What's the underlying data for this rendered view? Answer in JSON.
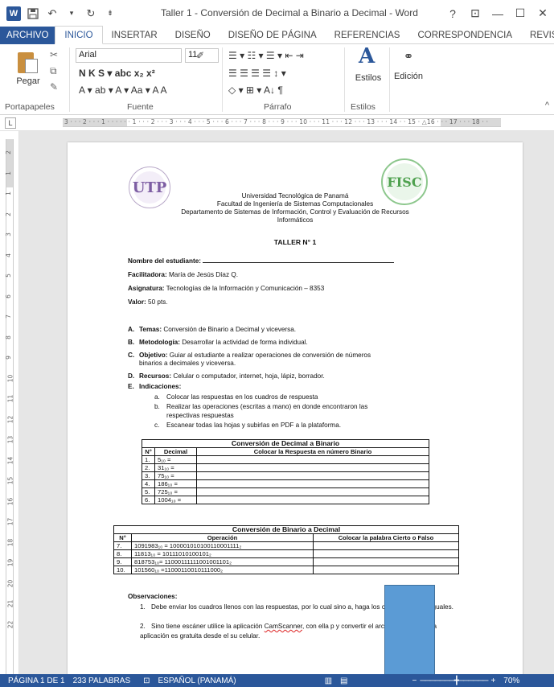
{
  "app": {
    "title": "Taller 1 - Conversión de Decimal a Binario a Decimal - Word",
    "window_controls": [
      "?",
      "⊡",
      "—",
      "☐",
      "✕"
    ]
  },
  "qat": {
    "icons": [
      "word-logo",
      "save-icon",
      "undo-icon",
      "redo-icon",
      "customize-icon"
    ],
    "word_logo_text": "W"
  },
  "tabs": [
    "ARCHIVO",
    "INICIO",
    "INSERTAR",
    "DISEÑO",
    "DISEÑO DE PÁGINA",
    "REFERENCIAS",
    "CORRESPONDENCIA",
    "REVISAR"
  ],
  "ribbon": {
    "paste_label": "Pegar",
    "font_name": "Arial",
    "font_size": "11",
    "styles_label": "Estilos",
    "edit_label": "Edición",
    "groups": [
      "Portapapeles",
      "Fuente",
      "Párrafo",
      "Estilos"
    ],
    "font_row1": "N  K  S ▾ abc  x₂  x²",
    "font_row2": "A ▾  ab ▾  A ▾  Aa ▾   A  A",
    "para_row1": "☰ ▾  ☷ ▾  ☰ ▾   ⇤  ⇥",
    "para_row2": "☰  ☰  ☰  ☰   ↕ ▾",
    "para_row3": "◇ ▾  ⊞ ▾   A↓   ¶"
  },
  "ruler": {
    "numbers": "3 · · · 2 · · · 1 · · ·   · · · 1 · · · 2 · · · 3 · · · 4 · · · 5 · · · 6 · · · 7 · · · 8 · · · 9 · · · 10 · · · 11 · · · 12 · · · 13 · · · 14 · · 15 · △16 · · · 17 · · · 18 · ·",
    "tab_selector": "L",
    "vertical_numbers": [
      "2",
      "1",
      "1",
      "2",
      "3",
      "4",
      "5",
      "6",
      "7",
      "8",
      "9",
      "10",
      "11",
      "12",
      "13",
      "14",
      "15",
      "16",
      "17",
      "18",
      "19",
      "20",
      "21",
      "22"
    ]
  },
  "document": {
    "logo_left_text": "UTP",
    "logo_right_text": "FISC",
    "header_lines": [
      "Universidad Tecnológica de Panamá",
      "Facultad de Ingeniería de Sistemas Computacionales",
      "Departamento de Sistemas de Información, Control y Evaluación de Recursos",
      "Informáticos"
    ],
    "title": "TALLER N° 1",
    "fields": {
      "student_label": "Nombre del estudiante:",
      "facilitator_label": "Facilitadora:",
      "facilitator_value": " María de Jesús Díaz Q.",
      "subject_label": "Asignatura:",
      "subject_value": " Tecnologías de la Información y Comunicación – 8353",
      "value_label": "Valor:",
      "value_value": " 50 pts."
    },
    "list": [
      {
        "letter": "A.",
        "label": "Temas:",
        "text": " Conversión de Binario a Decimal y viceversa."
      },
      {
        "letter": "B.",
        "label": "Metodología:",
        "text": " Desarrollar la actividad de forma individual."
      },
      {
        "letter": "C.",
        "label": "Objetivo:",
        "text": " Guiar al estudiante a realizar operaciones de conversión de números"
      },
      {
        "letter": "",
        "label": "",
        "text": "binarios a decimales y viceversa."
      },
      {
        "letter": "D.",
        "label": "Recursos:",
        "text": " Celular o computador, internet, hoja, lápiz, borrador."
      },
      {
        "letter": "E.",
        "label": "Indicaciones:",
        "text": ""
      }
    ],
    "indications": [
      {
        "letter": "a.",
        "text": "Colocar las respuestas en los cuadros de respuesta"
      },
      {
        "letter": "b.",
        "text": "Realizar las operaciones (escritas a mano) en donde encontraron las"
      },
      {
        "letter": "",
        "text": "respectivas respuestas"
      },
      {
        "letter": "c.",
        "text": "Escanear todas las hojas y subirlas en PDF a la plataforma."
      }
    ],
    "table1": {
      "caption": "Conversión de Decimal a Binario",
      "headers": [
        "N°",
        "Decimal",
        "Colocar la Respuesta en número Binario"
      ],
      "rows": [
        [
          "1.",
          "5₁₀ =",
          ""
        ],
        [
          "2.",
          "31₁₀ =",
          ""
        ],
        [
          "3.",
          "75₁₀ =",
          ""
        ],
        [
          "4.",
          "186₁₀ =",
          ""
        ],
        [
          "5.",
          "725₁₀ =",
          ""
        ],
        [
          "6.",
          "1004₁₀ =",
          ""
        ]
      ]
    },
    "table2": {
      "caption": "Conversión de Binario a Decimal",
      "headers": [
        "N°",
        "Operación",
        "Colocar la palabra Cierto o Falso"
      ],
      "rows": [
        [
          "7.",
          "1091983₁₀ = 100001010100110001111₂",
          ""
        ],
        [
          "8.",
          "11813₁₀ = 10111010100101₂",
          ""
        ],
        [
          "9.",
          "818753₁₀= 11000111111001001101₂",
          ""
        ],
        [
          "10.",
          "101560₁₀ =11000110010111000₂",
          ""
        ]
      ]
    },
    "observations": {
      "title": "Observaciones:",
      "items": [
        {
          "num": "1.",
          "text": "Debe enviar los cuadros llenos con las respuestas, por lo cual sino                a, haga los cuadros a mano iguales."
        },
        {
          "num": "2.",
          "text_before": "Sino tiene escáner utilice la aplicación ",
          "spell": "CamScanner",
          "text_after": ", con ella p                  y convertir el archivo en PDF. Esta aplicación es gratuita desde el                         su celular."
        }
      ]
    }
  },
  "status": {
    "page": "PÁGINA 1 DE 1",
    "words": "233 PALABRAS",
    "language": "ESPAÑOL (PANAMÁ)",
    "zoom": "70%",
    "zoom_minus": "−",
    "zoom_plus": "+"
  },
  "colors": {
    "accent": "#2b579a",
    "overlay_rect": "#5b9bd5"
  }
}
